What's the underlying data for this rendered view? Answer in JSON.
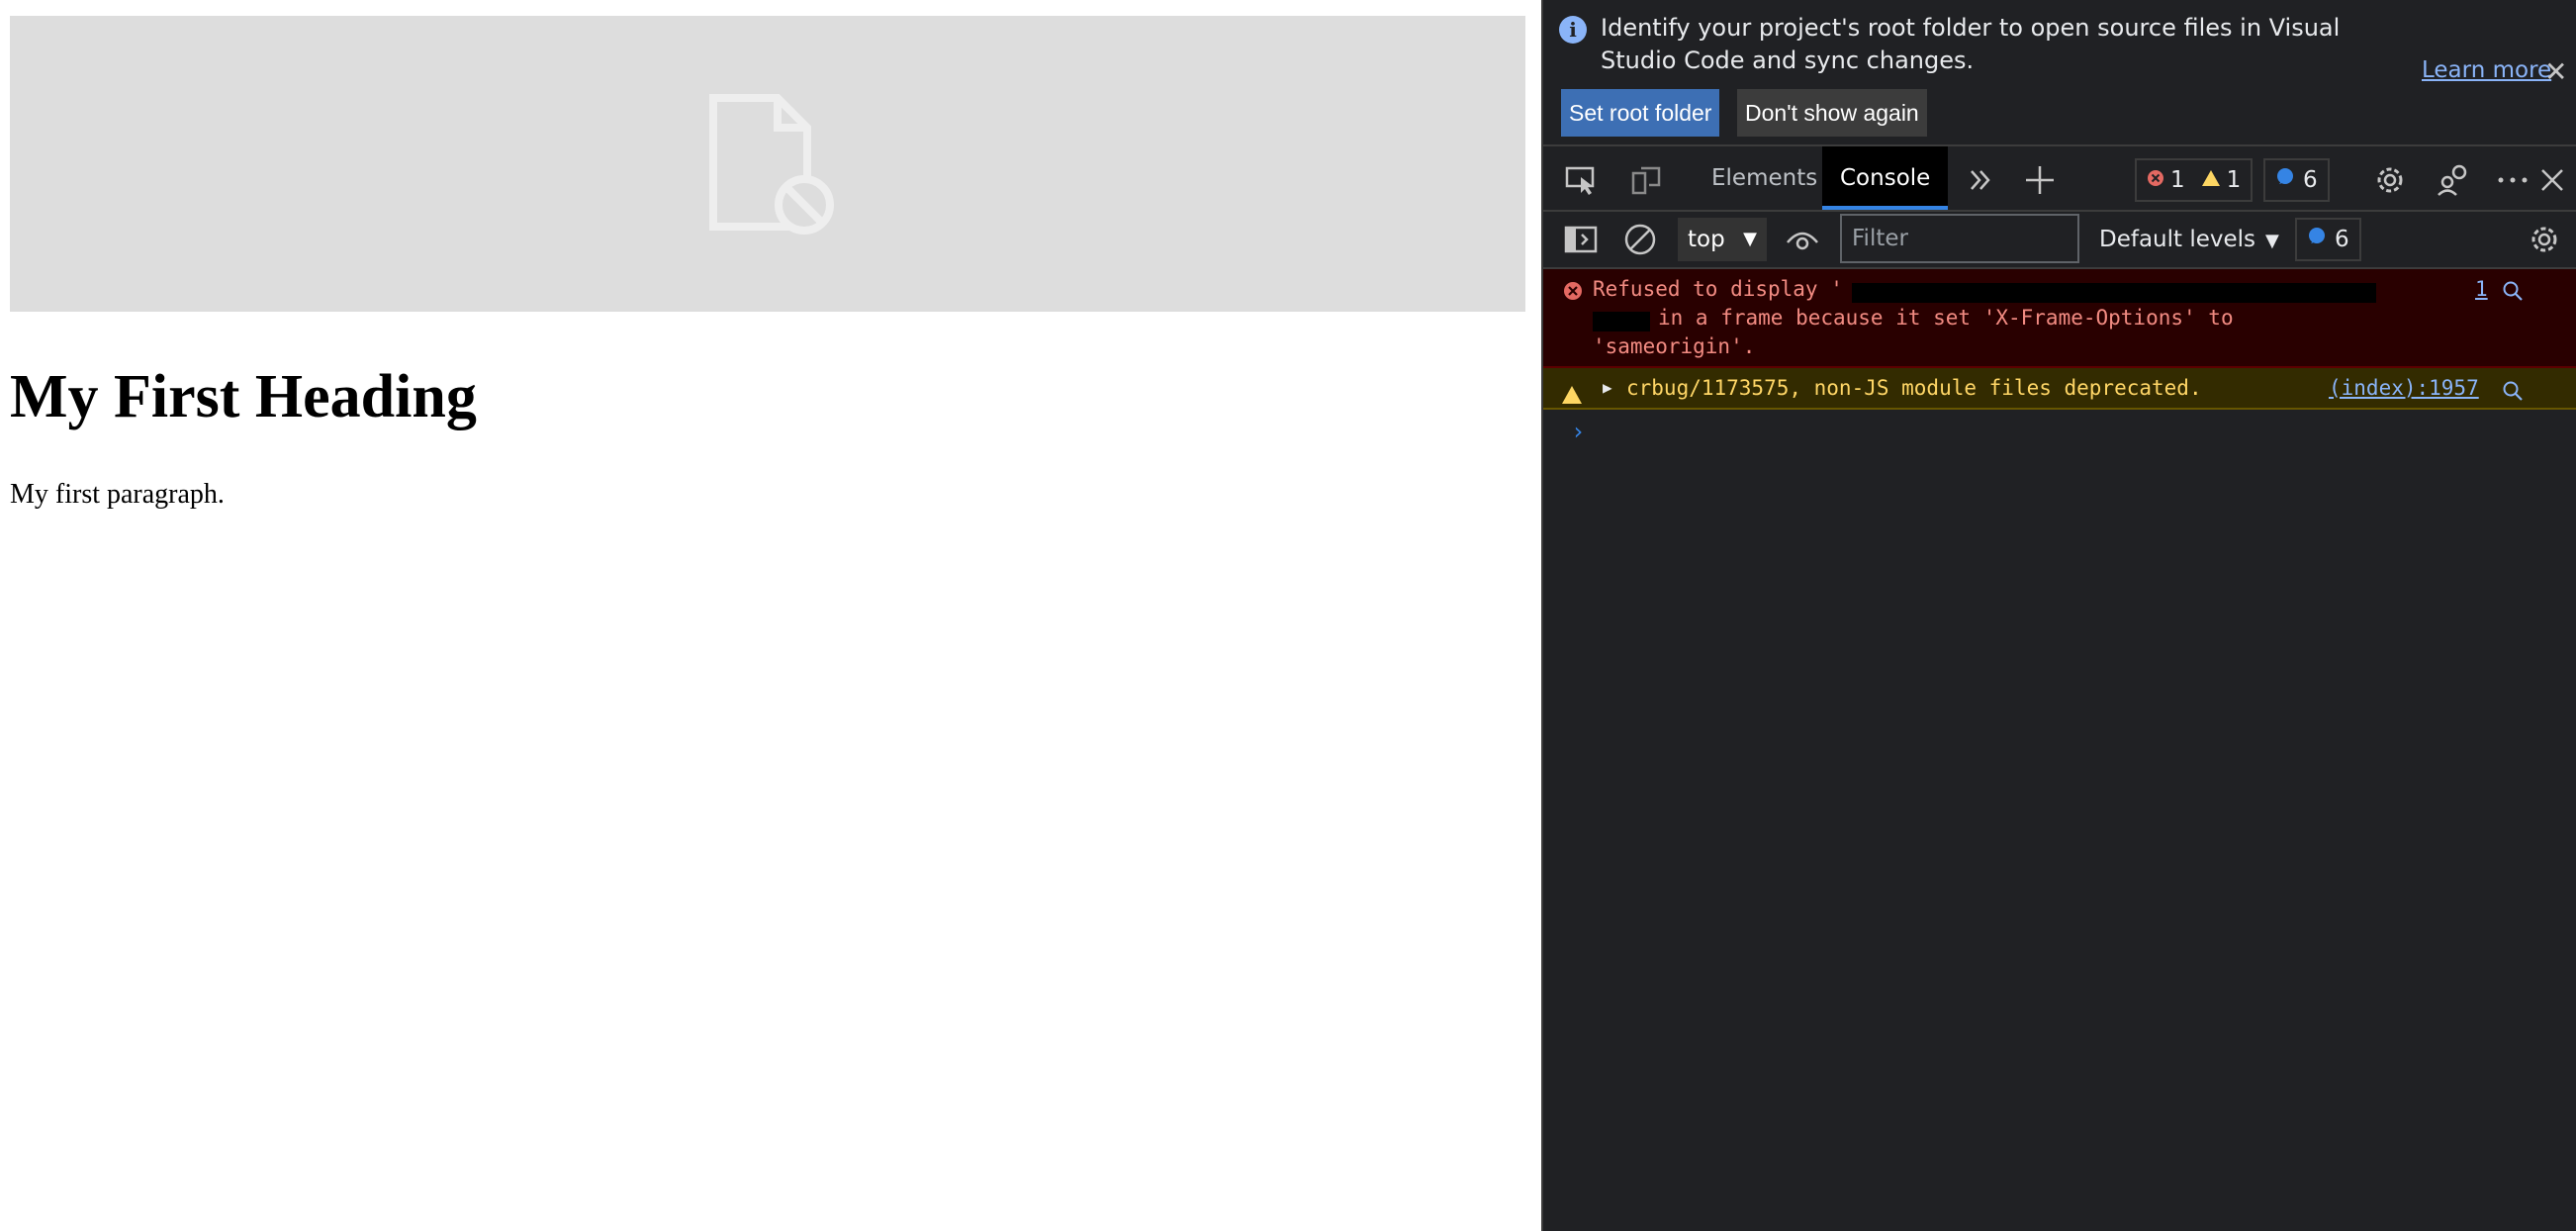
{
  "page": {
    "heading": "My First Heading",
    "paragraph": "My first paragraph."
  },
  "infobar": {
    "message": "Identify your project's root folder to open source files in Visual Studio Code and sync changes.",
    "learn_more": "Learn more",
    "set_root_label": "Set root folder",
    "dont_show_label": "Don't show again"
  },
  "tabs": {
    "elements": "Elements",
    "console": "Console"
  },
  "counts": {
    "errors": "1",
    "warnings": "1",
    "messages": "6"
  },
  "toolbar": {
    "context": "top",
    "filter_placeholder": "Filter",
    "levels": "Default levels",
    "messages": "6"
  },
  "console": {
    "error": {
      "line1": "Refused to display '",
      "line2": "in a frame because it set 'X-Frame-Options' to",
      "line3": "'sameorigin'.",
      "source": "1"
    },
    "warning": {
      "text": "crbug/1173575, non-JS module files deprecated.",
      "source": "(index):1957"
    }
  },
  "colors": {
    "accent": "#3584e4",
    "error": "#f28b82",
    "warning": "#ffd666",
    "panel_bg": "#202124"
  }
}
